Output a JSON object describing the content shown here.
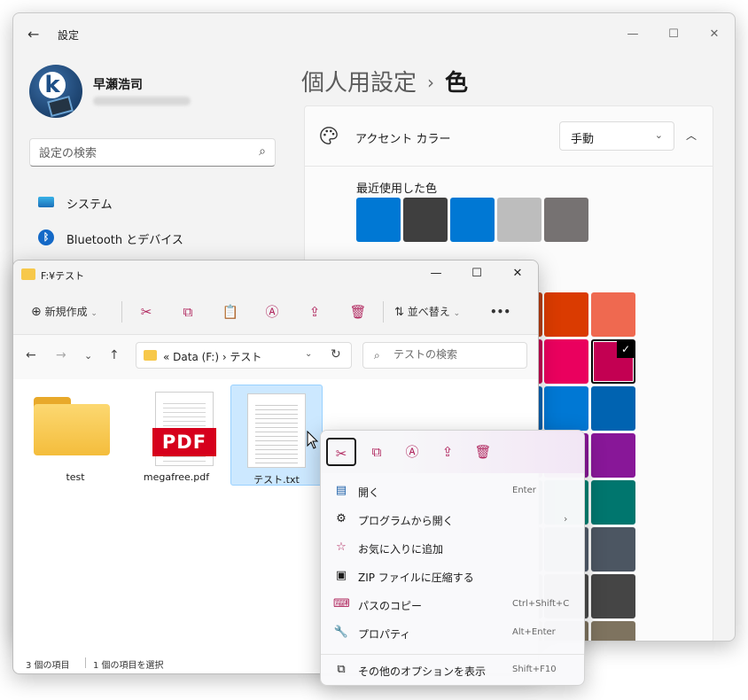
{
  "settings": {
    "title": "設定",
    "user_name": "早瀬浩司",
    "search_placeholder": "設定の検索",
    "nav": [
      {
        "label": "システム"
      },
      {
        "label": "Bluetooth とデバイス"
      }
    ],
    "breadcrumb_parent": "個人用設定",
    "breadcrumb_sep": "›",
    "breadcrumb_current": "色",
    "accent_label": "アクセント カラー",
    "accent_mode": "手動",
    "recent_colors_label": "最近使用した色",
    "recent_colors": [
      "#0078d4",
      "#3f3f3f",
      "#0078d4",
      "#bdbdbd",
      "#767272"
    ],
    "palette_visible": [
      [
        "#da3b01",
        "#ef6950"
      ],
      [
        "#ea005e",
        "#c30052"
      ],
      [
        "#0078d4",
        "#0063b1"
      ],
      [
        "#881798",
        "#881798"
      ],
      [
        "#008272",
        "#00766e"
      ],
      [
        "#515c6b",
        "#4c5662"
      ],
      [
        "#4a4a4a",
        "#454545"
      ],
      [
        "#7e735f",
        "#7e735f"
      ]
    ],
    "selected_swatch": "#c30052",
    "palette_edge_colors": [
      "#b73e12",
      "#c30052",
      "#0063b1",
      "#6d1f88",
      "#005e52",
      "#454f5c",
      "#3d3d3d",
      "#6b604e"
    ],
    "check_icon": "✓"
  },
  "explorer": {
    "title": "F:¥テスト",
    "toolbar": {
      "new_label": "新規作成",
      "sort_label": "並べ替え",
      "more": "•••"
    },
    "address": "«  Data (F:)  ›  テスト",
    "search_placeholder": "テストの検索",
    "files": [
      {
        "name": "test",
        "type": "folder"
      },
      {
        "name": "megafree.pdf",
        "type": "pdf"
      },
      {
        "name": "テスト.txt",
        "type": "txt"
      }
    ],
    "pdf_badge": "PDF",
    "status_count": "3 個の項目",
    "status_selected": "1 個の項目を選択"
  },
  "context_menu": {
    "items": [
      {
        "icon": "▤",
        "label": "開く",
        "shortcut": "Enter"
      },
      {
        "icon": "⚙",
        "label": "プログラムから開く",
        "shortcut": "",
        "arrow": "›"
      },
      {
        "icon": "☆",
        "label": "お気に入りに追加",
        "shortcut": ""
      },
      {
        "icon": "▣",
        "label": "ZIP ファイルに圧縮する",
        "shortcut": ""
      },
      {
        "icon": "⌨",
        "label": "パスのコピー",
        "shortcut": "Ctrl+Shift+C"
      },
      {
        "icon": "🔧",
        "label": "プロパティ",
        "shortcut": "Alt+Enter"
      },
      {
        "icon": "⧉",
        "label": "その他のオプションを表示",
        "shortcut": "Shift+F10"
      }
    ]
  }
}
